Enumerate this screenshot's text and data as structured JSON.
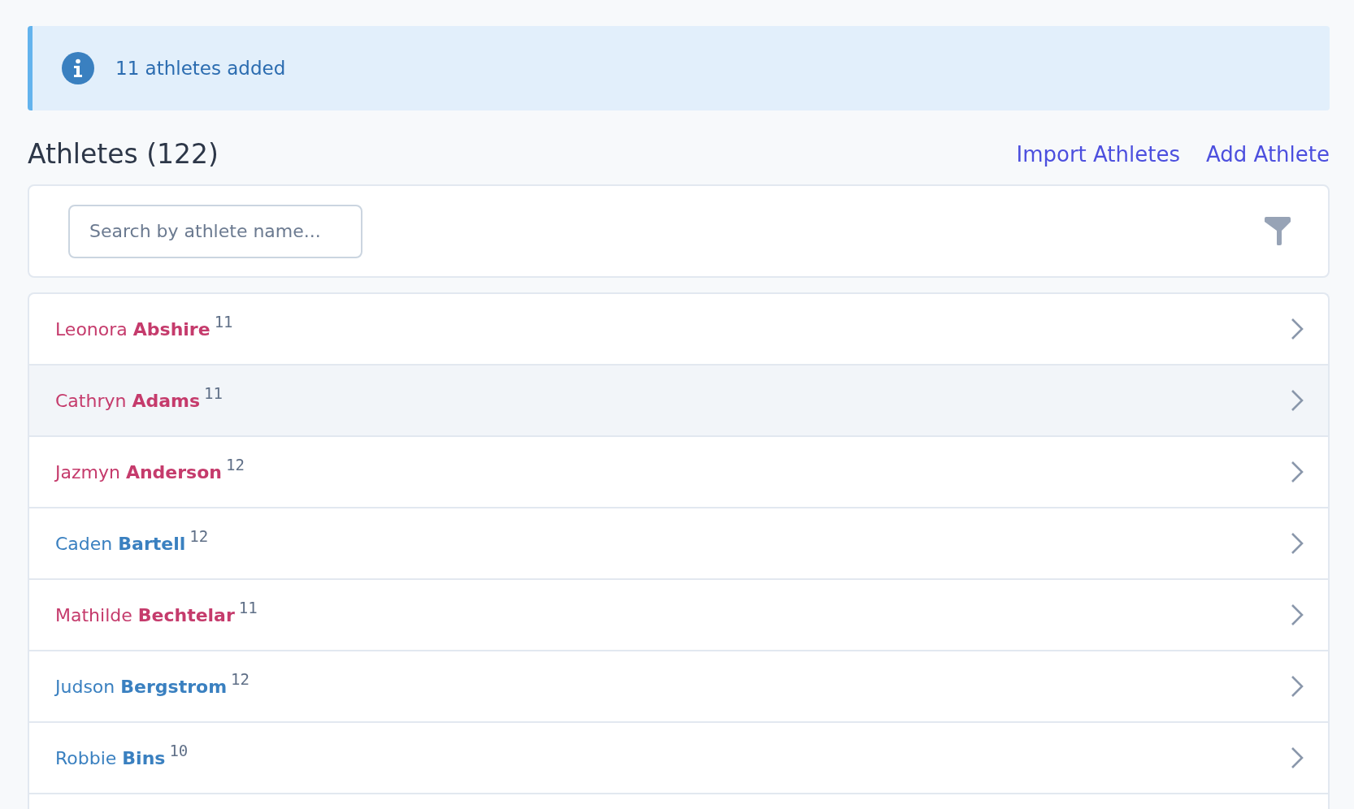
{
  "alert": {
    "message": "11 athletes added"
  },
  "header": {
    "title": "Athletes (122)",
    "links": [
      "Import Athletes",
      "Add Athlete"
    ]
  },
  "search": {
    "placeholder": "Search by athlete name..."
  },
  "athletes": [
    {
      "name": "Leonora **Abshire**",
      "grade": "11",
      "color": "#c53b6c",
      "highlighted": false
    },
    {
      "name": "Cathryn **Adams**",
      "grade": "11",
      "color": "#c53b6c",
      "highlighted": true
    },
    {
      "name": "Jazmyn **Anderson**",
      "grade": "12",
      "color": "#c53b6c",
      "highlighted": false
    },
    {
      "name": "Caden **Bartell**",
      "grade": "12",
      "color": "#3a80c0",
      "highlighted": false
    },
    {
      "name": "Mathilde **Bechtelar**",
      "grade": "11",
      "color": "#c53b6c",
      "highlighted": false
    },
    {
      "name": "Judson **Bergstrom**",
      "grade": "12",
      "color": "#3a80c0",
      "highlighted": false
    },
    {
      "name": "Robbie **Bins**",
      "grade": "10",
      "color": "#3a80c0",
      "highlighted": false
    }
  ]
}
